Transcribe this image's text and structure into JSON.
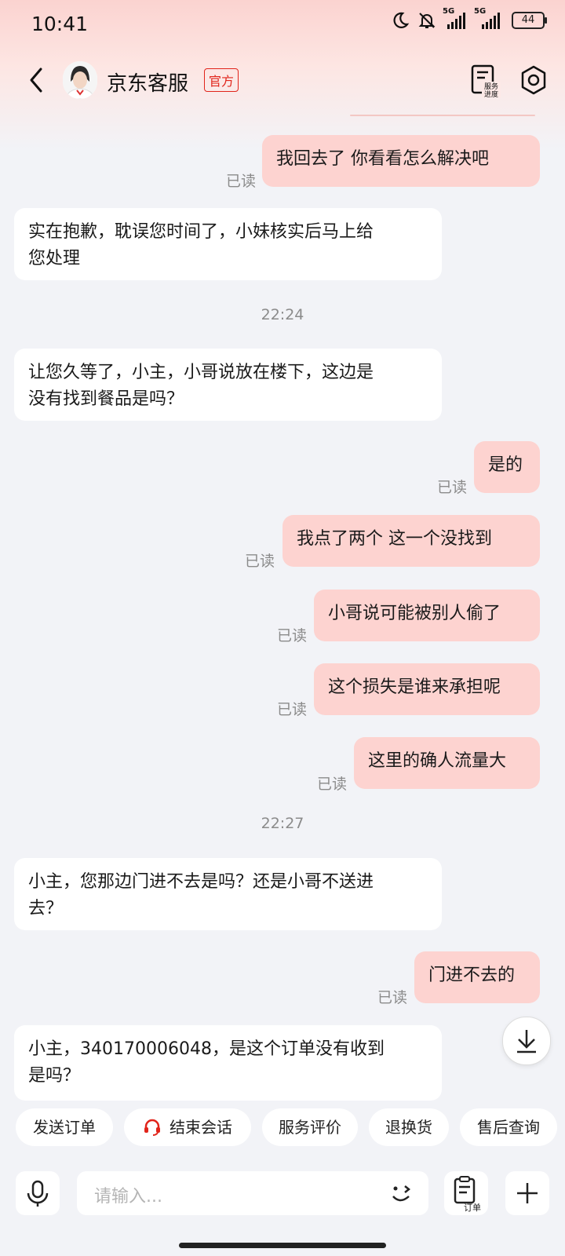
{
  "status": {
    "time": "10:41",
    "net1": "5G",
    "net2": "5G",
    "battery": "44"
  },
  "header": {
    "title": "京东客服",
    "badge": "官方",
    "service_label_1": "服务",
    "service_label_2": "进度"
  },
  "messages": [
    {
      "dir": "out",
      "text": "我回去了  你看看怎么解决吧",
      "read": "已读"
    },
    {
      "dir": "in",
      "line1": "实在抱歉，耽误您时间了，小妹核实后马上给",
      "line2": "您处理"
    },
    {
      "dir": "time",
      "text": "22:24"
    },
    {
      "dir": "in",
      "line1": "让您久等了，小主，小哥说放在楼下，这边是",
      "line2": "没有找到餐品是吗？"
    },
    {
      "dir": "out",
      "text": "是的",
      "read": "已读"
    },
    {
      "dir": "out",
      "text": "我点了两个  这一个没找到",
      "read": "已读"
    },
    {
      "dir": "out",
      "text": "小哥说可能被别人偷了",
      "read": "已读"
    },
    {
      "dir": "out",
      "text": "这个损失是谁来承担呢",
      "read": "已读"
    },
    {
      "dir": "out",
      "text": "这里的确人流量大",
      "read": "已读"
    },
    {
      "dir": "time",
      "text": "22:27"
    },
    {
      "dir": "in",
      "line1": "小主，您那边门进不去是吗？还是小哥不送进",
      "line2": "去？"
    },
    {
      "dir": "out",
      "text": "门进不去的",
      "read": "已读"
    },
    {
      "dir": "in",
      "line1": "小主，340170006048，是这个订单没有收到",
      "line2": "是吗？"
    }
  ],
  "quick_actions": [
    "发送订单",
    "结束会话",
    "服务评价",
    "退换货",
    "售后查询"
  ],
  "input": {
    "placeholder": "请输入...",
    "order_label": "订单"
  },
  "colors": {
    "accent": "#e1251b",
    "out_bubble": "#fdd3d0",
    "in_bubble": "#ffffff",
    "page_bg": "#f2f3f7"
  }
}
